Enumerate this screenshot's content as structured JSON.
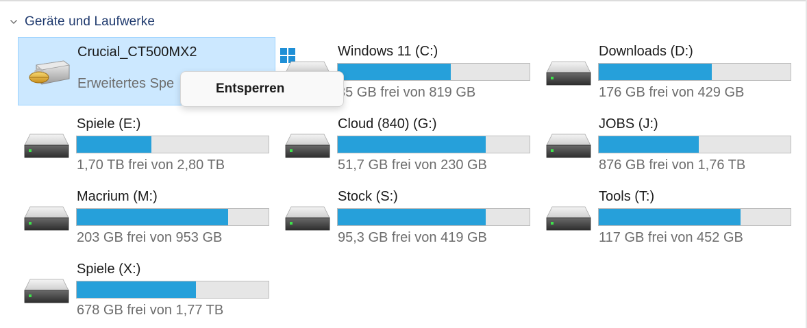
{
  "section": {
    "title": "Geräte und Laufwerke",
    "icon": "chevron-down-icon"
  },
  "colors": {
    "bar_fill": "#26a0da",
    "bar_empty": "#e6e6e6",
    "selection": "#cce8ff",
    "section_title": "#1f3a6e"
  },
  "drives": [
    {
      "name": "Crucial_CT500MX2",
      "subtitle": "Erweitertes Spe",
      "icon": "locked-drive-icon",
      "selected": true
    },
    {
      "name": "Windows 11 (C:)",
      "free": "35 GB frei von 819 GB",
      "used_fraction": 0.59,
      "icon": "windows-drive-icon"
    },
    {
      "name": "Downloads (D:)",
      "free": "176 GB frei von 429 GB",
      "used_fraction": 0.59,
      "icon": "drive-icon"
    },
    {
      "name": "Spiele (E:)",
      "free": "1,70 TB frei von 2,80 TB",
      "used_fraction": 0.39,
      "icon": "drive-icon"
    },
    {
      "name": "Cloud (840) (G:)",
      "free": "51,7 GB frei von 230 GB",
      "used_fraction": 0.77,
      "icon": "drive-icon"
    },
    {
      "name": "JOBS (J:)",
      "free": "876 GB frei von 1,76 TB",
      "used_fraction": 0.52,
      "icon": "drive-icon"
    },
    {
      "name": "Macrium (M:)",
      "free": "203 GB frei von 953 GB",
      "used_fraction": 0.79,
      "icon": "drive-icon"
    },
    {
      "name": "Stock (S:)",
      "free": "95,3 GB frei von 419 GB",
      "used_fraction": 0.77,
      "icon": "drive-icon"
    },
    {
      "name": "Tools (T:)",
      "free": "117 GB frei von 452 GB",
      "used_fraction": 0.74,
      "icon": "drive-icon"
    },
    {
      "name": "Spiele (X:)",
      "free": "678 GB frei von 1,77 TB",
      "used_fraction": 0.62,
      "icon": "drive-icon"
    }
  ],
  "context_menu": {
    "items": [
      {
        "label": "Entsperren"
      }
    ]
  }
}
